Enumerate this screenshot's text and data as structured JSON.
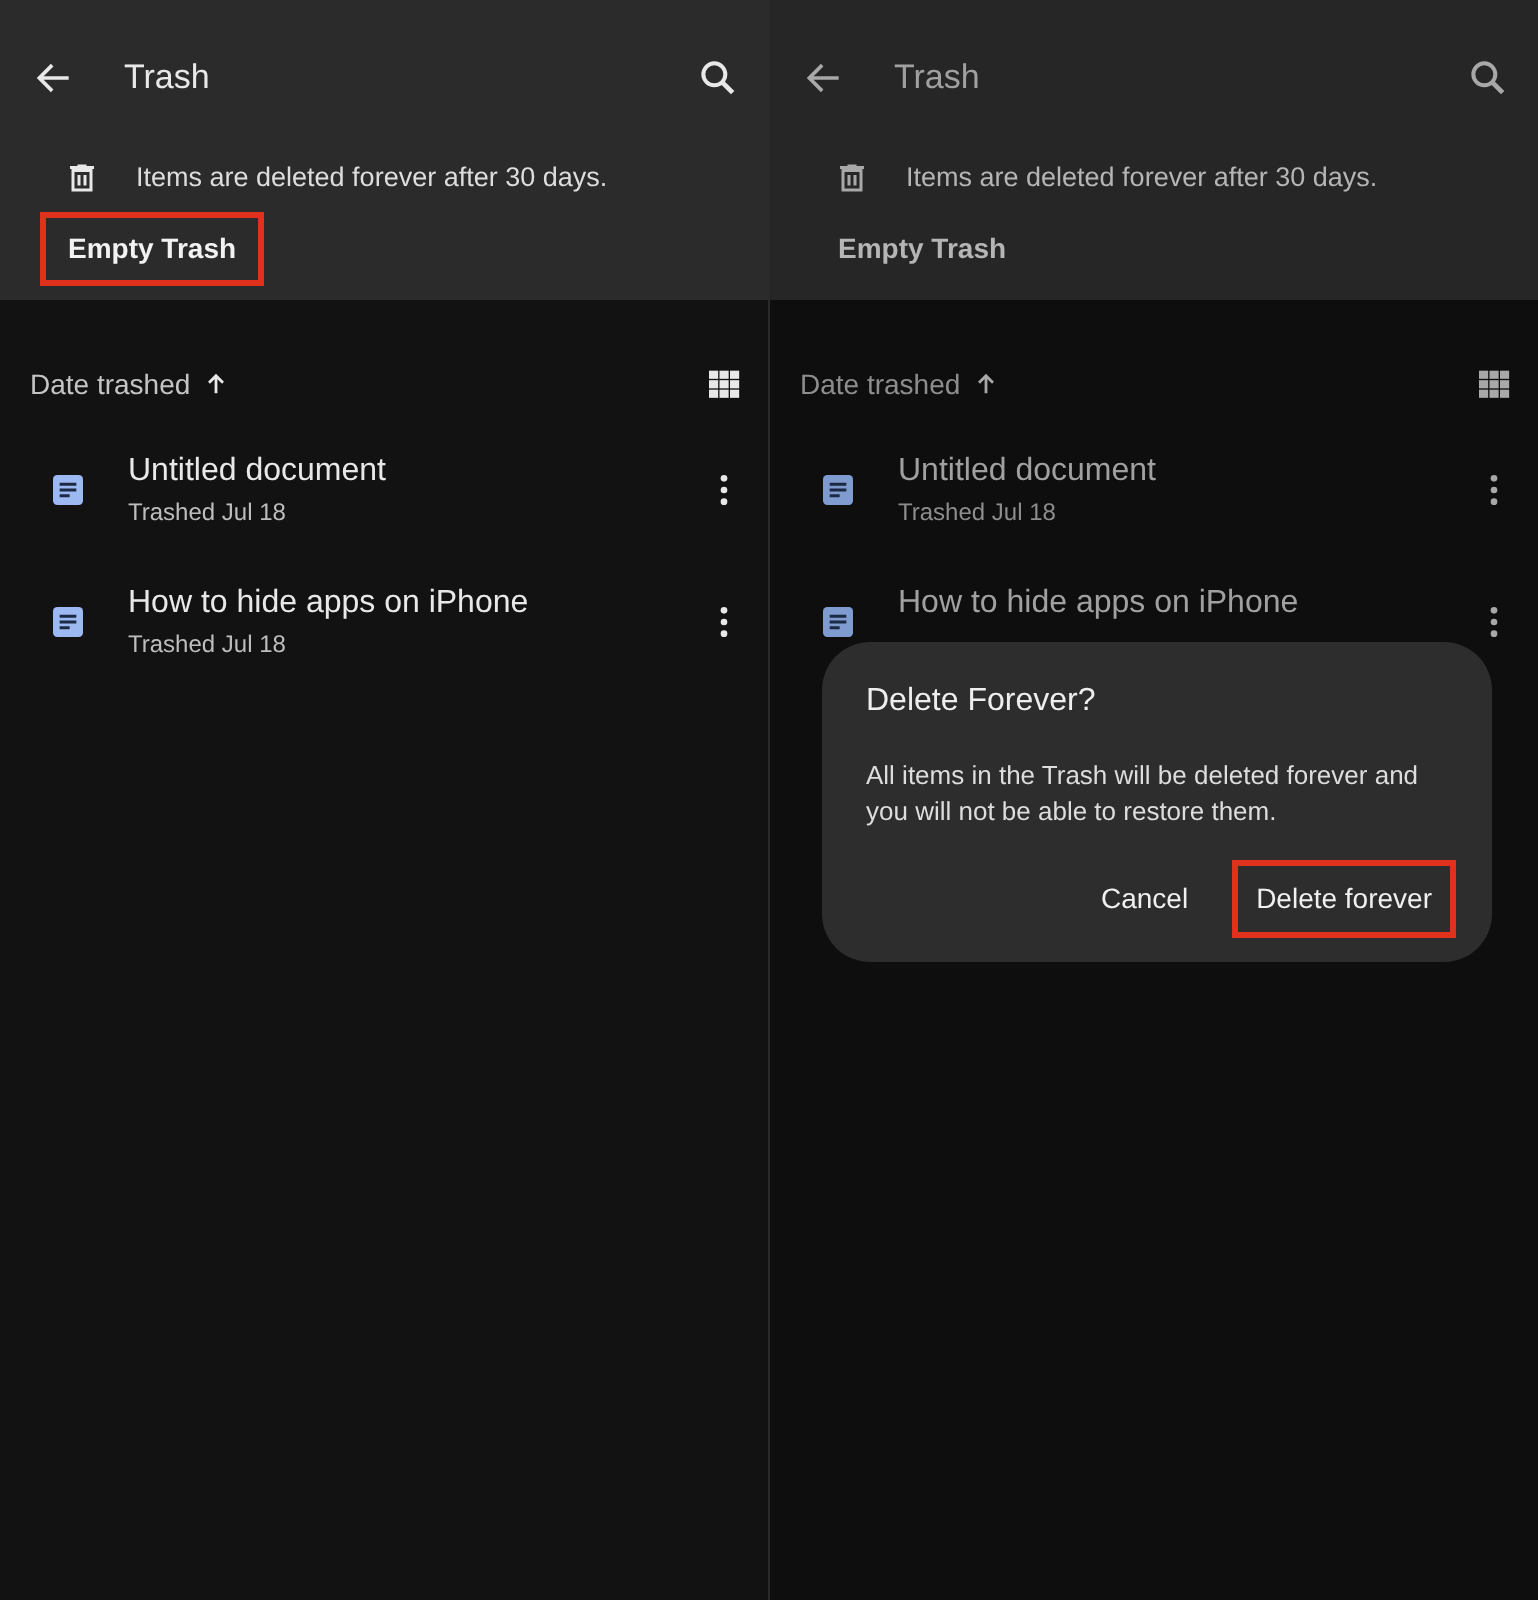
{
  "panels": [
    {
      "title": "Trash",
      "notice": "Items are deleted forever after 30 days.",
      "empty_button": {
        "label": "Empty Trash",
        "highlighted": true
      },
      "sort_label": "Date trashed",
      "dimmed": false,
      "files": [
        {
          "name": "Untitled document",
          "date": "Trashed Jul 18"
        },
        {
          "name": "How to hide apps on iPhone",
          "date": "Trashed Jul 18"
        }
      ]
    },
    {
      "title": "Trash",
      "notice": "Items are deleted forever after 30 days.",
      "empty_button": {
        "label": "Empty Trash",
        "highlighted": false
      },
      "sort_label": "Date trashed",
      "dimmed": true,
      "files": [
        {
          "name": "Untitled document",
          "date": "Trashed Jul 18"
        },
        {
          "name": "How to hide apps on iPhone"
        }
      ],
      "dialog": {
        "title": "Delete Forever?",
        "message": "All items in the Trash will be deleted forever and you will not be able to restore them.",
        "buttons": [
          {
            "label": "Cancel",
            "highlighted": false
          },
          {
            "label": "Delete forever",
            "highlighted": true
          }
        ]
      }
    }
  ]
}
